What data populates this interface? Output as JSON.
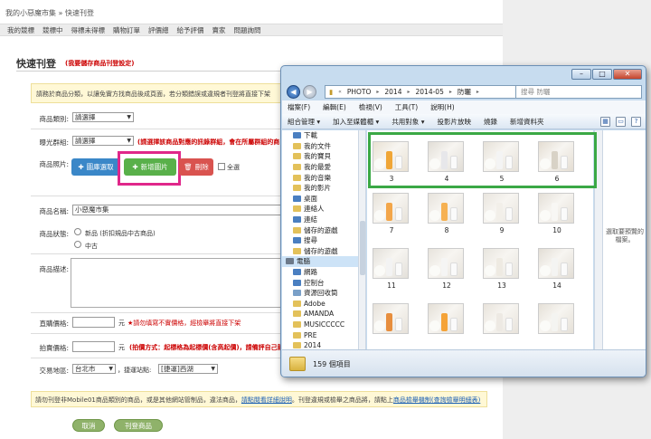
{
  "colors": {
    "accent_red": "#cc0000",
    "button_blue": "#3a87c8",
    "button_green": "#59b04a",
    "button_red": "#d9534f",
    "highlight_pink": "#e0278a",
    "highlight_green": "#3aa845"
  },
  "breadcrumb": "我的小惡魔市集 » 快速刊登",
  "tabs": [
    "我的競標",
    "競標中",
    "得標未得標",
    "購物訂單",
    "評價總",
    "給予評價",
    "賣家",
    "問題詢問"
  ],
  "form": {
    "title": "快速刊登",
    "title_note": "(我要儲存商品刊登設定)",
    "notice": "請務於商品分類，以讓免實方找商品後成頁面，若分類錯誤或違規者刊登將直接下架",
    "category_label": "商品類別:",
    "category_value": "請選擇",
    "group_label": "曝光群組:",
    "group_value": "請選擇",
    "group_hint": "(請選擇該商品對應的訊錄群組，會在所屬群組的商",
    "photo_label": "商品照片:",
    "btn_select": "圖庫選取",
    "btn_add": "新增圖片",
    "btn_delete": "刪除",
    "select_all": "全選",
    "name_label": "商品名稱:",
    "name_value": "小惡魔市集",
    "condition_label": "商品狀態:",
    "condition_new": "新品 (折扣規品中古商品)",
    "condition_used": "中古",
    "desc_label": "商品描述:",
    "price_label": "直購價格:",
    "price_unit": "元",
    "price_hint": "★請勿填寫不實價格，經檢舉將直接下架",
    "bid_label": "拍賣價格:",
    "bid_unit": "元",
    "bid_hint": "(拍價方式：起標格為起標價(含高起價)，請備評自己競標)",
    "location_label": "交易地區:",
    "city_value": "台北市",
    "station_label": "，捷運站點:",
    "station_value": "[捷運]西湖",
    "bottom_note_pre": "請勿刊登非Mobile01商品類別的商品，或是其他網站管制品，違法商品，",
    "bottom_note_link1": "請點閱看詳細說明",
    "bottom_note_mid": "。刊登違規或檢舉之商品將，請點上",
    "bottom_note_link2": "商品檢舉機制",
    "bottom_note_end": "(查詢檢舉明細表)",
    "btn_cancel": "取消",
    "btn_submit": "刊登商品"
  },
  "explorer": {
    "path": [
      "PHOTO",
      "2014",
      "2014-05",
      "防曬"
    ],
    "search_placeholder": "搜尋 防曬",
    "menu": [
      "檔案(F)",
      "編輯(E)",
      "檢視(V)",
      "工具(T)",
      "說明(H)"
    ],
    "toolbar": [
      "組合管理 ▾",
      "加入至媒體櫃 ▾",
      "共用對象 ▾",
      "投影片放映",
      "燒錄",
      "新增資料夾"
    ],
    "nav": [
      {
        "label": "下載",
        "color": "#4a7fc1"
      },
      {
        "label": "我的文件",
        "color": "#e3c15a"
      },
      {
        "label": "我的寶貝",
        "color": "#e3c15a"
      },
      {
        "label": "我的最愛",
        "color": "#e3c15a"
      },
      {
        "label": "我的音樂",
        "color": "#e3c15a"
      },
      {
        "label": "我的影片",
        "color": "#e3c15a"
      },
      {
        "label": "桌面",
        "color": "#4a7fc1"
      },
      {
        "label": "連絡人",
        "color": "#e3c15a"
      },
      {
        "label": "連結",
        "color": "#4a7fc1"
      },
      {
        "label": "儲存的遊戲",
        "color": "#e3c15a"
      },
      {
        "label": "搜尋",
        "color": "#4a7fc1"
      },
      {
        "label": "儲存的遊戲",
        "color": "#e3c15a"
      },
      {
        "label": "電腦",
        "color": "#6d7a8a",
        "selected": true
      },
      {
        "label": "網路",
        "color": "#4a7fc1"
      },
      {
        "label": "控制台",
        "color": "#4a7fc1"
      },
      {
        "label": "資源回收筒",
        "color": "#7aa0c8"
      },
      {
        "label": "Adobe",
        "color": "#e3c15a"
      },
      {
        "label": "AMANDA",
        "color": "#e3c15a"
      },
      {
        "label": "MUSICCCCC",
        "color": "#e3c15a"
      },
      {
        "label": "PRE",
        "color": "#e3c15a"
      },
      {
        "label": "2014",
        "color": "#e3c15a"
      }
    ],
    "thumbs": [
      {
        "label": "3",
        "tone": "#e9e1d3",
        "accent": "#f0a637"
      },
      {
        "label": "4",
        "tone": "#e1ddd6",
        "accent": "#e7e7ea"
      },
      {
        "label": "5",
        "tone": "#e6e1d8",
        "accent": "#f4f4f4"
      },
      {
        "label": "6",
        "tone": "#e4ddd2",
        "accent": "#d8d2c6"
      },
      {
        "label": "7",
        "tone": "#e6e1d8",
        "accent": "#f3a64a"
      },
      {
        "label": "8",
        "tone": "#e7e3dc",
        "accent": "#f6b152"
      },
      {
        "label": "9",
        "tone": "#e9e5de",
        "accent": "#f2efe9"
      },
      {
        "label": "10",
        "tone": "#e4dfd7",
        "accent": "#f8f7f4"
      },
      {
        "label": "11",
        "tone": "#e3e0da",
        "accent": "#f3f3f3"
      },
      {
        "label": "12",
        "tone": "#e7e3dc",
        "accent": "#f5f5f4"
      },
      {
        "label": "13",
        "tone": "#e8e5de",
        "accent": "#eeeae2"
      },
      {
        "label": "14",
        "tone": "#e2ddd5",
        "accent": "#f4f4f2"
      },
      {
        "label": "",
        "tone": "#e6e1d9",
        "accent": "#e78e3e"
      },
      {
        "label": "",
        "tone": "#e4dfd6",
        "accent": "#f5a338"
      },
      {
        "label": "",
        "tone": "#e8e3db",
        "accent": "#ede9e3"
      },
      {
        "label": "",
        "tone": "#e5e0d7",
        "accent": "#f4f4f1"
      }
    ],
    "preview_text": "選取要預覽的檔案。",
    "status": "159 個項目"
  }
}
